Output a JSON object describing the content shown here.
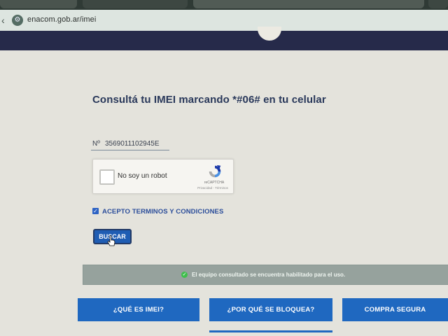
{
  "browser": {
    "url": "enacom.gob.ar/imei",
    "icons": {
      "back": "arrow-icon",
      "site": "site-settings-icon"
    }
  },
  "page": {
    "title": "Consultá tu IMEI marcando *#06# en tu celular",
    "imei_field": {
      "prefix": "Nº",
      "value": "3569011102945E"
    },
    "recaptcha": {
      "label": "No soy un robot",
      "brand": "reCAPTCHA",
      "links": "Privacidad - Términos"
    },
    "terms": {
      "label": "ACEPTO TERMINOS Y CONDICIONES",
      "checked": true
    },
    "search_button": "BUSCAR",
    "result": {
      "message": "El equipo consultado se encuentra habilitado para el uso.",
      "status_color": "#3fbf4c"
    },
    "nav": {
      "what_is_imei": "¿QUÉ ES IMEI?",
      "why_blocked": "¿POR QUÉ SE BLOQUEA?",
      "safe_purchase": "COMPRA SEGURA"
    }
  },
  "colors": {
    "header": "#262a4a",
    "accent": "#1f68c0",
    "title": "#29385a"
  }
}
